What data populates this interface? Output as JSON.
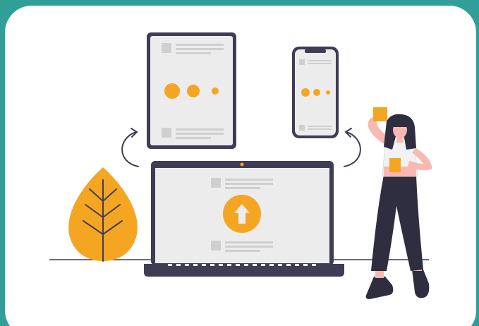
{
  "illustration": {
    "subject": "responsive-design",
    "icons": [
      "tablet-icon",
      "phone-icon",
      "laptop-icon",
      "upload-arrow-icon",
      "tree-icon",
      "person-figure",
      "curved-arrow-icon"
    ]
  },
  "colors": {
    "frame": "#2f9f98",
    "card": "#ffffff",
    "device_body": "#3f3d56",
    "screen": "#ececec",
    "accent": "#f4a623",
    "placeholder_box": "#cfcfcf",
    "placeholder_line": "#cfcfcf",
    "skin": "#f7b9b2",
    "hair": "#2f2e41",
    "ground": "#3f3d56"
  }
}
